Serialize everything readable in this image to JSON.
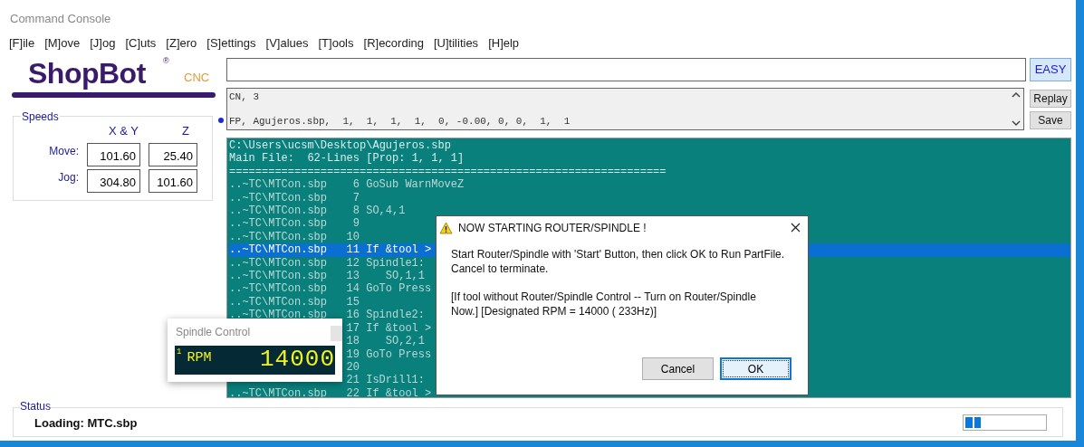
{
  "window": {
    "title": "Command Console"
  },
  "menu": [
    "[F]ile",
    "[M]ove",
    "[J]og",
    "[C]uts",
    "[Z]ero",
    "[S]ettings",
    "[V]alues",
    "[T]ools",
    "[R]ecording",
    "[U]tilities",
    "[H]elp"
  ],
  "logo": {
    "name": "ShopBot",
    "mark": "®",
    "suffix": "CNC"
  },
  "speeds": {
    "title": "Speeds",
    "columns": [
      "X & Y",
      "Z"
    ],
    "rows": [
      {
        "label": "Move:",
        "values": [
          "101.60",
          "25.40"
        ]
      },
      {
        "label": "Jog:",
        "values": [
          "304.80",
          "101.60"
        ]
      }
    ]
  },
  "command": {
    "easy_button": "EASY"
  },
  "history": {
    "lines": [
      {
        "text": "CN, 3",
        "selected": false
      },
      {
        "text": "FP, Agujeros.sbp,  1,  1,  1,  1,  0, -0.00, 0, 0,  1,  1",
        "selected": true
      }
    ],
    "buttons": [
      "Replay",
      "Save"
    ]
  },
  "console": {
    "header": [
      "C:\\Users\\ucsm\\Desktop\\Agujeros.sbp",
      "Main File:  62-Lines [Prop: 1, 1, 1]",
      "==================================================================="
    ],
    "rows": [
      {
        "file": "..~TC\\MTCon.sbp",
        "line": "6",
        "code": "GoSub WarnMoveZ",
        "indented": false,
        "selected": false
      },
      {
        "file": "..~TC\\MTCon.sbp",
        "line": "7",
        "selected": false
      },
      {
        "file": "..~TC\\MTCon.sbp",
        "line": "8",
        "code": "SO,4,1",
        "indented": false,
        "selected": false
      },
      {
        "file": "..~TC\\MTCon.sbp",
        "line": "9",
        "selected": false
      },
      {
        "file": "..~TC\\MTCon.sbp",
        "line": "10",
        "selected": false
      },
      {
        "file": "..~TC\\MTCon.sbp",
        "line": "11",
        "code": "If &tool >",
        "indented": false,
        "selected": true
      },
      {
        "file": "..~TC\\MTCon.sbp",
        "line": "12",
        "code": "Spindle1:",
        "indented": false,
        "selected": false
      },
      {
        "file": "..~TC\\MTCon.sbp",
        "line": "13",
        "code": "SO,1,1",
        "indented": true,
        "selected": false
      },
      {
        "file": "..~TC\\MTCon.sbp",
        "line": "14",
        "code": "GoTo Press",
        "indented": false,
        "selected": false
      },
      {
        "file": "..~TC\\MTCon.sbp",
        "line": "15",
        "selected": false
      },
      {
        "file": "..~TC\\MTCon.sbp",
        "line": "16",
        "code": "Spindle2:",
        "indented": false,
        "selected": false
      },
      {
        "line": "17",
        "code": "If &tool >",
        "indented": false,
        "selected": false
      },
      {
        "line": "18",
        "code": "SO,2,1",
        "indented": true,
        "selected": false
      },
      {
        "line": "19",
        "code": "GoTo Press",
        "indented": false,
        "selected": false
      },
      {
        "line": "20",
        "selected": false
      },
      {
        "line": "21",
        "code": "IsDrill1:",
        "indented": false,
        "selected": false
      },
      {
        "file": "..~TC\\MTCon.sbp",
        "line": "22",
        "code": "If &tool >",
        "indented": false,
        "selected": false
      }
    ]
  },
  "spindle_control": {
    "title": "Spindle Control",
    "index": "1",
    "unit": "RPM",
    "value": "14000"
  },
  "dialog": {
    "title": "NOW STARTING ROUTER/SPINDLE !",
    "paragraphs": [
      [
        "Start Router/Spindle with 'Start' Button, then click OK to Run PartFile.",
        "Cancel to terminate."
      ],
      [
        "[If tool without Router/Spindle Control -- Turn on Router/Spindle",
        "Now.]  [Designated RPM = 14000 ( 233Hz)]"
      ]
    ],
    "buttons": [
      {
        "label": "Cancel",
        "selected": false
      },
      {
        "label": "OK",
        "selected": true
      }
    ]
  },
  "status": {
    "title": "Status",
    "message": "Loading: MTC.sbp",
    "progress": {
      "level": 0.2
    }
  }
}
